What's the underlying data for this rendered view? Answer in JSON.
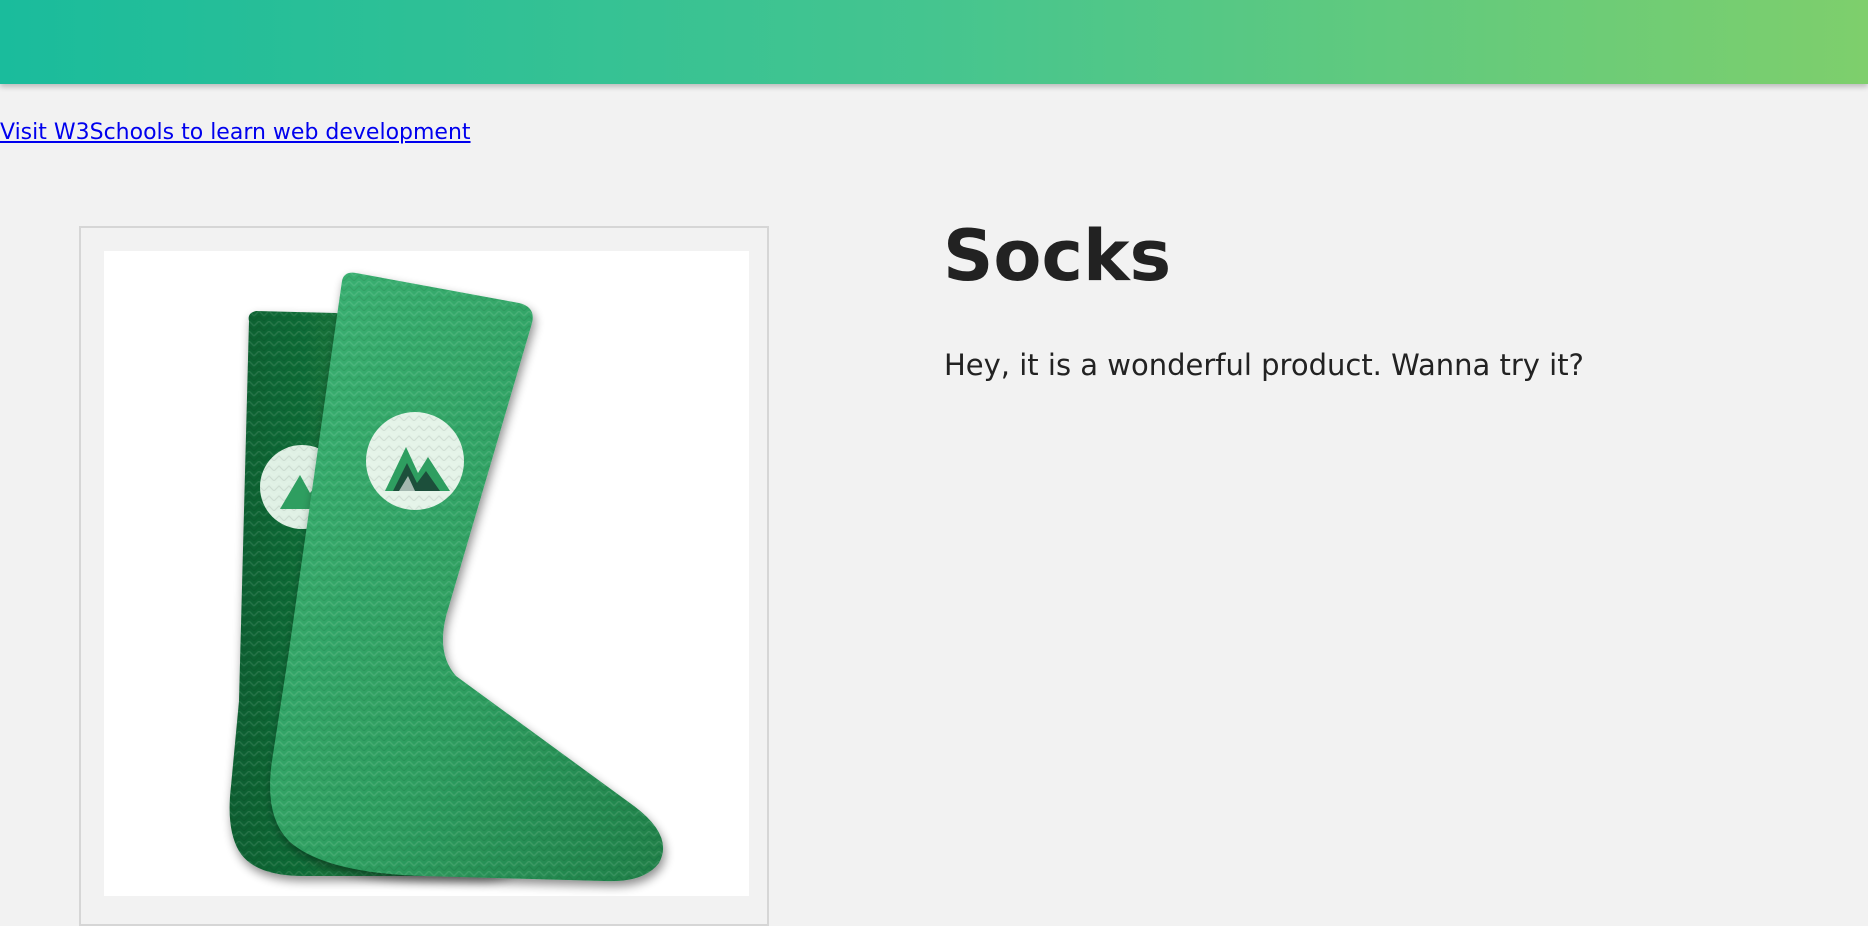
{
  "header": {
    "gradient_start": "#1abc9c",
    "gradient_end": "#7ecf6c"
  },
  "link": {
    "text": "Visit W3Schools to learn web development",
    "color": "#0000ee"
  },
  "product": {
    "title": "Socks",
    "description": "Hey, it is a wonderful product. Wanna try it?",
    "image_icon": "green-socks-image",
    "sock_color": "#2e9e60"
  }
}
